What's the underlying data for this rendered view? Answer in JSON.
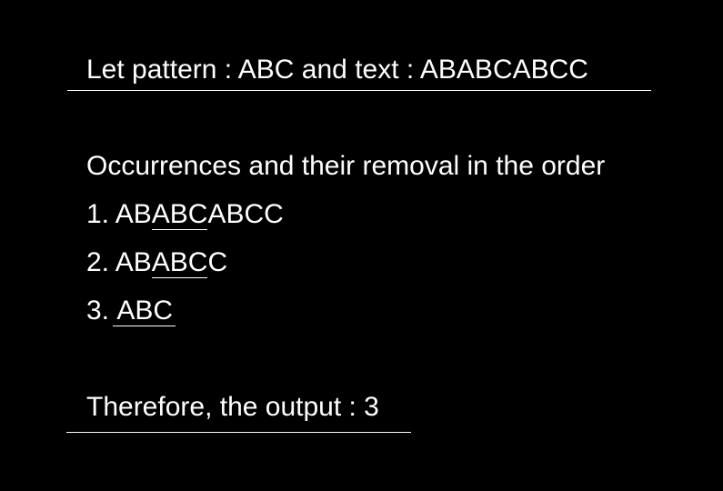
{
  "header": {
    "text": "Let pattern : ABC and text : ABABCABCC"
  },
  "section": {
    "heading": "Occurrences and their removal in the order",
    "steps": [
      {
        "num": "1.",
        "before": "AB",
        "match": "ABC",
        "after": "ABCC"
      },
      {
        "num": "2.",
        "before": "AB",
        "match": "ABC",
        "after": "C"
      },
      {
        "num": "3.",
        "before": "",
        "match": "ABC",
        "after": ""
      }
    ]
  },
  "result": {
    "text": "Therefore, the output : 3"
  }
}
